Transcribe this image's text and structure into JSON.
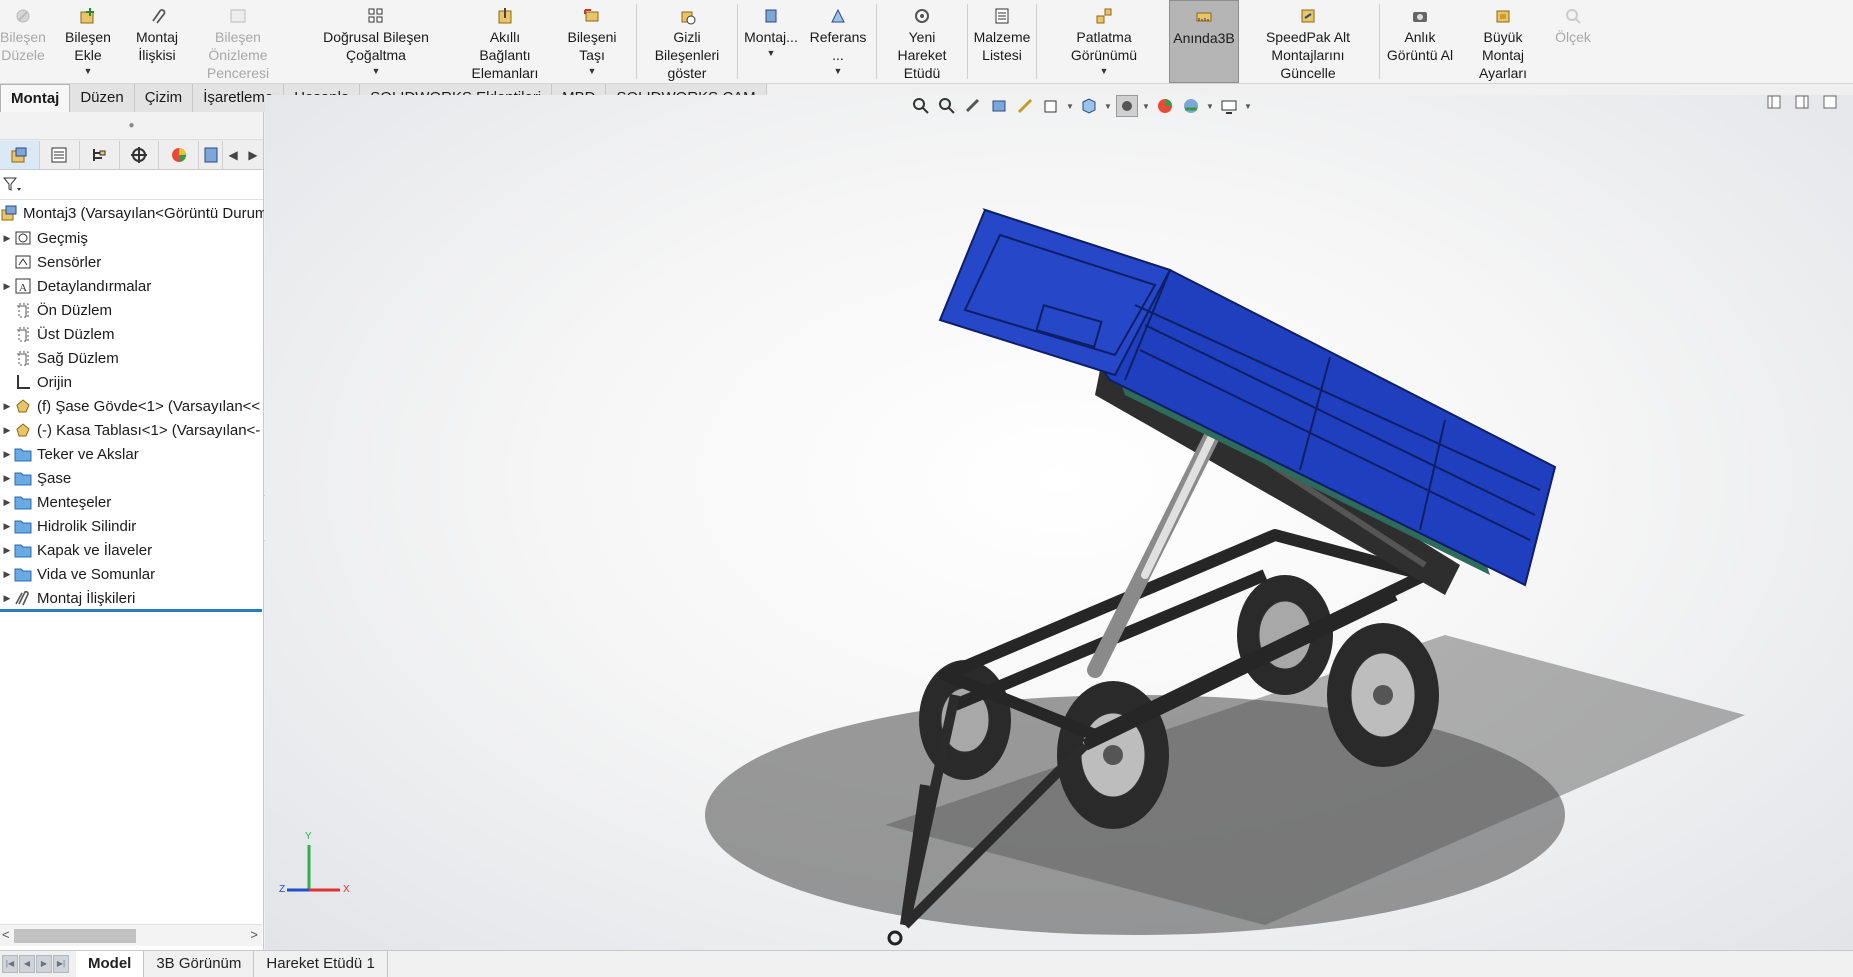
{
  "ribbon": {
    "buttons": [
      {
        "id": "edit-component",
        "label": "Bileşen\nDüzele",
        "enabled": false,
        "icon": "edit-component-icon"
      },
      {
        "id": "insert-components",
        "label": "Bileşen Ekle",
        "enabled": true,
        "icon": "insert-component-icon",
        "dropdown": true
      },
      {
        "id": "mate",
        "label": "Montaj\nİlişkisi",
        "enabled": true,
        "icon": "mate-paperclip-icon"
      },
      {
        "id": "component-preview",
        "label": "Bileşen Önizleme\nPenceresi",
        "enabled": false,
        "icon": "preview-window-icon"
      },
      {
        "id": "linear-pattern",
        "label": "Doğrusal Bileşen Çoğaltma",
        "enabled": true,
        "icon": "linear-pattern-icon",
        "dropdown": true
      },
      {
        "id": "smart-fasteners",
        "label": "Akıllı Bağlantı\nElemanları",
        "enabled": true,
        "icon": "smart-fastener-icon"
      },
      {
        "id": "move-component",
        "label": "Bileşeni Taşı",
        "enabled": true,
        "icon": "move-component-icon",
        "dropdown": true
      },
      {
        "id": "show-hidden",
        "label": "Gizli Bileşenleri\ngöster",
        "enabled": true,
        "icon": "show-hidden-icon"
      },
      {
        "id": "assembly-features",
        "label": "Montaj...",
        "enabled": true,
        "icon": "assembly-features-icon",
        "dropdown": true
      },
      {
        "id": "reference-geometry",
        "label": "Referans ...",
        "enabled": true,
        "icon": "reference-geometry-icon",
        "dropdown": true
      },
      {
        "id": "new-motion-study",
        "label": "Yeni Hareket\nEtüdü",
        "enabled": true,
        "icon": "motion-study-icon"
      },
      {
        "id": "bill-of-materials",
        "label": "Malzeme\nListesi",
        "enabled": true,
        "icon": "bom-icon"
      },
      {
        "id": "exploded-view",
        "label": "Patlatma Görünümü",
        "enabled": true,
        "icon": "exploded-view-icon",
        "dropdown": true
      },
      {
        "id": "instant3d",
        "label": "Anında3B",
        "enabled": true,
        "icon": "instant3d-icon",
        "active": true
      },
      {
        "id": "speedpak",
        "label": "SpeedPak Alt\nMontajlarını Güncelle",
        "enabled": true,
        "icon": "speedpak-icon"
      },
      {
        "id": "snapshot",
        "label": "Anlık\nGörüntü Al",
        "enabled": true,
        "icon": "camera-icon"
      },
      {
        "id": "large-assembly",
        "label": "Büyük Montaj\nAyarları",
        "enabled": true,
        "icon": "large-assembly-icon"
      },
      {
        "id": "measure",
        "label": "Ölçek",
        "enabled": false,
        "icon": "measure-icon"
      }
    ]
  },
  "cm_tabs": [
    "Montaj",
    "Düzen",
    "Çizim",
    "İşaretleme",
    "Hesapla",
    "SOLIDWORKS Eklentileri",
    "MBD",
    "SOLIDWORKS CAM"
  ],
  "cm_active": "Montaj",
  "tree": {
    "root": "Montaj3  (Varsayılan<Görüntü Durum",
    "nodes": [
      {
        "label": "Geçmiş",
        "icon": "history-icon",
        "expandable": true
      },
      {
        "label": "Sensörler",
        "icon": "sensor-icon",
        "expandable": false
      },
      {
        "label": "Detaylandırmalar",
        "icon": "annotations-icon",
        "expandable": true
      },
      {
        "label": "Ön Düzlem",
        "icon": "plane-icon",
        "expandable": false
      },
      {
        "label": "Üst Düzlem",
        "icon": "plane-icon",
        "expandable": false
      },
      {
        "label": "Sağ Düzlem",
        "icon": "plane-icon",
        "expandable": false
      },
      {
        "label": "Orijin",
        "icon": "origin-icon",
        "expandable": false
      },
      {
        "label": "(f) Şase Gövde<1> (Varsayılan<<",
        "icon": "part-icon",
        "expandable": true
      },
      {
        "label": "(-) Kasa Tablası<1> (Varsayılan<-",
        "icon": "part-icon",
        "expandable": true
      },
      {
        "label": "Teker ve Akslar",
        "icon": "folder-icon",
        "expandable": true
      },
      {
        "label": "Şase",
        "icon": "folder-icon",
        "expandable": true
      },
      {
        "label": "Menteşeler",
        "icon": "folder-icon",
        "expandable": true
      },
      {
        "label": "Hidrolik Silindir",
        "icon": "folder-icon",
        "expandable": true
      },
      {
        "label": "Kapak ve İlaveler",
        "icon": "folder-icon",
        "expandable": true
      },
      {
        "label": "Vida ve Somunlar",
        "icon": "folder-icon",
        "expandable": true
      },
      {
        "label": "Montaj İlişkileri",
        "icon": "mates-folder-icon",
        "expandable": true
      }
    ]
  },
  "triad": {
    "x": "X",
    "y": "Y",
    "z": "Z"
  },
  "bottom_tabs": [
    "Model",
    "3B Görünüm",
    "Hareket Etüdü 1"
  ],
  "bottom_active": "Model",
  "colors": {
    "body_blue": "#1f3fbf",
    "frame_dark": "#2b2b2b",
    "accent_green": "#2e6b5a",
    "selection_blue": "#2a7ac0"
  }
}
